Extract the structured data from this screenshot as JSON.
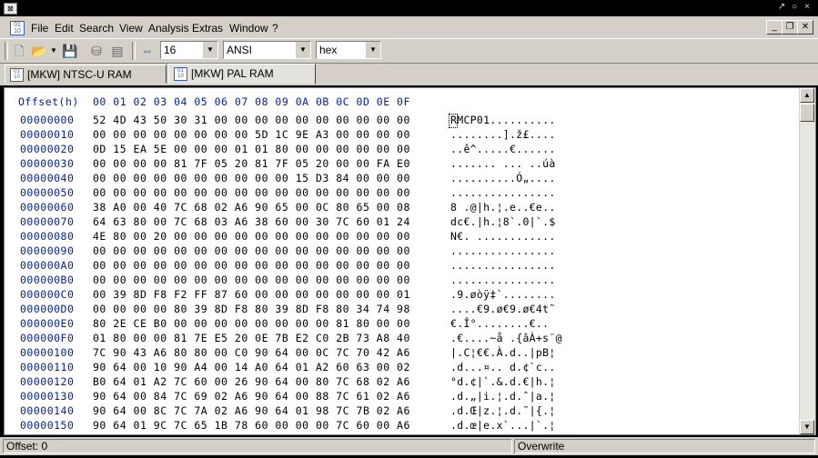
{
  "menu": {
    "items": [
      "File",
      "Edit",
      "Search",
      "View",
      "Analysis",
      "Extras",
      "Window",
      "?"
    ]
  },
  "toolbar": {
    "bytes_per_line": "16",
    "charset": "ANSI",
    "display_mode": "hex"
  },
  "tabs": [
    {
      "label": "[MKW] NTSC-U RAM Dump.bin"
    },
    {
      "label": "[MKW] PAL RAM Dump.bin"
    }
  ],
  "editor": {
    "offset_header": "Offset(h)",
    "column_header": "00 01 02 03 04 05 06 07 08 09 0A 0B 0C 0D 0E 0F",
    "rows": [
      {
        "offset": "00000000",
        "bytes": "52 4D 43 50 30 31 00 00 00 00 00 00 00 00 00 00",
        "text": "RMCP01.........."
      },
      {
        "offset": "00000010",
        "bytes": "00 00 00 00 00 00 00 00 5D 1C 9E A3 00 00 00 00",
        "text": "........].ž£...."
      },
      {
        "offset": "00000020",
        "bytes": "0D 15 EA 5E 00 00 00 01 01 80 00 00 00 00 00 00",
        "text": "..ê^.....€......"
      },
      {
        "offset": "00000030",
        "bytes": "00 00 00 00 81 7F 05 20 81 7F 05 20 00 00 FA E0",
        "text": "....... ... ..úà"
      },
      {
        "offset": "00000040",
        "bytes": "00 00 00 00 00 00 00 00 00 00 15 D3 84 00 00 00",
        "text": "..........Ó„...."
      },
      {
        "offset": "00000050",
        "bytes": "00 00 00 00 00 00 00 00 00 00 00 00 00 00 00 00",
        "text": "................"
      },
      {
        "offset": "00000060",
        "bytes": "38 A0 00 40 7C 68 02 A6 90 65 00 0C 80 65 00 08",
        "text": "8 .@|h.¦.e..€e.."
      },
      {
        "offset": "00000070",
        "bytes": "64 63 80 00 7C 68 03 A6 38 60 00 30 7C 60 01 24",
        "text": "dc€.|h.¦8`.0|`.$"
      },
      {
        "offset": "00000080",
        "bytes": "4E 80 00 20 00 00 00 00 00 00 00 00 00 00 00 00",
        "text": "N€. ............"
      },
      {
        "offset": "00000090",
        "bytes": "00 00 00 00 00 00 00 00 00 00 00 00 00 00 00 00",
        "text": "................"
      },
      {
        "offset": "000000A0",
        "bytes": "00 00 00 00 00 00 00 00 00 00 00 00 00 00 00 00",
        "text": "................"
      },
      {
        "offset": "000000B0",
        "bytes": "00 00 00 00 00 00 00 00 00 00 00 00 00 00 00 00",
        "text": "................"
      },
      {
        "offset": "000000C0",
        "bytes": "00 39 8D F8 F2 FF 87 60 00 00 00 00 00 00 00 01",
        "text": ".9.øòÿ‡`........"
      },
      {
        "offset": "000000D0",
        "bytes": "00 00 00 00 80 39 8D F8 80 39 8D F8 80 34 74 98",
        "text": "....€9.ø€9.ø€4t˜"
      },
      {
        "offset": "000000E0",
        "bytes": "80 2E CE B0 00 00 00 00 00 00 00 00 81 80 00 00",
        "text": "€.Î°........€.."
      },
      {
        "offset": "000000F0",
        "bytes": "01 80 00 00 81 7E E5 20 0E 7B E2 C0 2B 73 A8 40",
        "text": ".€....~å .{âÀ+s¨@"
      },
      {
        "offset": "00000100",
        "bytes": "7C 90 43 A6 80 80 00 C0 90 64 00 0C 7C 70 42 A6",
        "text": "|.C¦€€.À.d..|pB¦"
      },
      {
        "offset": "00000110",
        "bytes": "90 64 00 10 90 A4 00 14 A0 64 01 A2 60 63 00 02",
        "text": ".d...¤.. d.¢`c.."
      },
      {
        "offset": "00000120",
        "bytes": "B0 64 01 A2 7C 60 00 26 90 64 00 80 7C 68 02 A6",
        "text": "°d.¢|`.&.d.€|h.¦"
      },
      {
        "offset": "00000130",
        "bytes": "90 64 00 84 7C 69 02 A6 90 64 00 88 7C 61 02 A6",
        "text": ".d.„|i.¦.d.ˆ|a.¦"
      },
      {
        "offset": "00000140",
        "bytes": "90 64 00 8C 7C 7A 02 A6 90 64 01 98 7C 7B 02 A6",
        "text": ".d.Œ|z.¦.d.˜|{.¦"
      },
      {
        "offset": "00000150",
        "bytes": "90 64 01 9C 7C 65 1B 78 60 00 00 00 7C 60 00 A6",
        "text": ".d.œ|e.x`...|`.¦"
      }
    ]
  },
  "status": {
    "offset": "Offset: 0",
    "mode": "Overwrite"
  }
}
